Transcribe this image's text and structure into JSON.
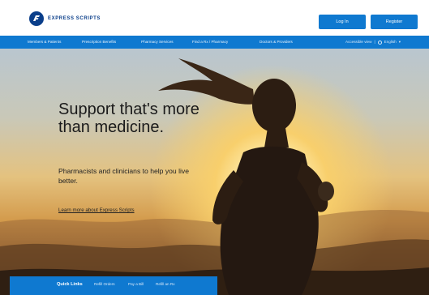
{
  "header": {
    "brand": "EXPRESS SCRIPTS",
    "login_label": "Log In",
    "register_label": "Register"
  },
  "nav": {
    "items": [
      "Members & Patients",
      "Prescription Benefits",
      "Pharmacy Services",
      "Find a Rx / Pharmacy",
      "Doctors & Providers"
    ],
    "right_text": "Accessible view",
    "lang_label": "English"
  },
  "hero": {
    "headline": "Support that's more than medicine.",
    "subtext": "Pharmacists and clinicians to help you live better.",
    "link": "Learn more about Express Scripts"
  },
  "quick_links": {
    "title": "Quick Links",
    "items": [
      "Refill Orders",
      "Pay a Bill",
      "Refill an Rx"
    ]
  },
  "colors": {
    "brand_blue": "#0f79d0",
    "logo_navy": "#0a3e8a"
  }
}
